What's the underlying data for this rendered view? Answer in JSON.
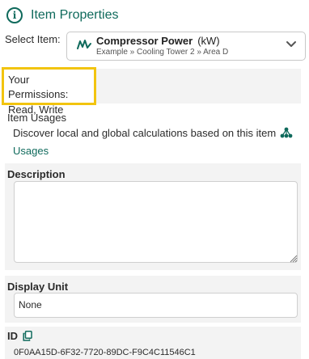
{
  "header": {
    "icon": "info-icon",
    "title": "Item Properties"
  },
  "select_item": {
    "label": "Select Item:",
    "item_icon": "signal-icon",
    "item_name": "Compressor Power",
    "item_unit": "(kW)",
    "item_path": "Example » Cooling Tower 2 » Area D",
    "dropdown_icon": "chevron-down-icon"
  },
  "permissions": {
    "label": "Your Permissions:",
    "value": "Read, Write",
    "highlight_color": "#f2c40f"
  },
  "usages": {
    "title": "Item Usages",
    "description": "Discover local and global calculations based on this item",
    "icon": "tree-icon",
    "link_label": "Usages"
  },
  "description": {
    "label": "Description",
    "value": ""
  },
  "display_unit": {
    "label": "Display Unit",
    "value": "None"
  },
  "id": {
    "label": "ID",
    "copy_icon": "copy-icon",
    "value": "0F0AA15D-6F32-7720-89DC-F9C4C11546C1"
  },
  "colors": {
    "accent": "#0f6a5c",
    "panel_bg": "#f3f3f3"
  }
}
